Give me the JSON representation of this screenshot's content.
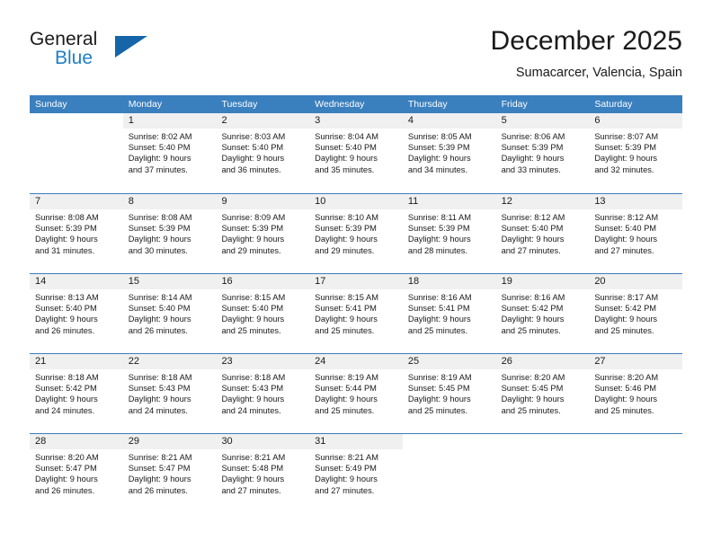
{
  "brand": {
    "name_primary": "General",
    "name_secondary": "Blue",
    "logo_icon": "triangle-logo-icon",
    "accent_color": "#1565a8"
  },
  "header": {
    "title": "December 2025",
    "subtitle": "Sumacarcer, Valencia, Spain"
  },
  "calendar": {
    "header_color": "#3a7fbe",
    "daynum_band_color": "#f0f0f0",
    "weekdays": [
      "Sunday",
      "Monday",
      "Tuesday",
      "Wednesday",
      "Thursday",
      "Friday",
      "Saturday"
    ],
    "weeks": [
      [
        {
          "day": "",
          "sunrise": "",
          "sunset": "",
          "daylight_line1": "",
          "daylight_line2": "",
          "blank": true
        },
        {
          "day": "1",
          "sunrise": "Sunrise: 8:02 AM",
          "sunset": "Sunset: 5:40 PM",
          "daylight_line1": "Daylight: 9 hours",
          "daylight_line2": "and 37 minutes."
        },
        {
          "day": "2",
          "sunrise": "Sunrise: 8:03 AM",
          "sunset": "Sunset: 5:40 PM",
          "daylight_line1": "Daylight: 9 hours",
          "daylight_line2": "and 36 minutes."
        },
        {
          "day": "3",
          "sunrise": "Sunrise: 8:04 AM",
          "sunset": "Sunset: 5:40 PM",
          "daylight_line1": "Daylight: 9 hours",
          "daylight_line2": "and 35 minutes."
        },
        {
          "day": "4",
          "sunrise": "Sunrise: 8:05 AM",
          "sunset": "Sunset: 5:39 PM",
          "daylight_line1": "Daylight: 9 hours",
          "daylight_line2": "and 34 minutes."
        },
        {
          "day": "5",
          "sunrise": "Sunrise: 8:06 AM",
          "sunset": "Sunset: 5:39 PM",
          "daylight_line1": "Daylight: 9 hours",
          "daylight_line2": "and 33 minutes."
        },
        {
          "day": "6",
          "sunrise": "Sunrise: 8:07 AM",
          "sunset": "Sunset: 5:39 PM",
          "daylight_line1": "Daylight: 9 hours",
          "daylight_line2": "and 32 minutes."
        }
      ],
      [
        {
          "day": "7",
          "sunrise": "Sunrise: 8:08 AM",
          "sunset": "Sunset: 5:39 PM",
          "daylight_line1": "Daylight: 9 hours",
          "daylight_line2": "and 31 minutes."
        },
        {
          "day": "8",
          "sunrise": "Sunrise: 8:08 AM",
          "sunset": "Sunset: 5:39 PM",
          "daylight_line1": "Daylight: 9 hours",
          "daylight_line2": "and 30 minutes."
        },
        {
          "day": "9",
          "sunrise": "Sunrise: 8:09 AM",
          "sunset": "Sunset: 5:39 PM",
          "daylight_line1": "Daylight: 9 hours",
          "daylight_line2": "and 29 minutes."
        },
        {
          "day": "10",
          "sunrise": "Sunrise: 8:10 AM",
          "sunset": "Sunset: 5:39 PM",
          "daylight_line1": "Daylight: 9 hours",
          "daylight_line2": "and 29 minutes."
        },
        {
          "day": "11",
          "sunrise": "Sunrise: 8:11 AM",
          "sunset": "Sunset: 5:39 PM",
          "daylight_line1": "Daylight: 9 hours",
          "daylight_line2": "and 28 minutes."
        },
        {
          "day": "12",
          "sunrise": "Sunrise: 8:12 AM",
          "sunset": "Sunset: 5:40 PM",
          "daylight_line1": "Daylight: 9 hours",
          "daylight_line2": "and 27 minutes."
        },
        {
          "day": "13",
          "sunrise": "Sunrise: 8:12 AM",
          "sunset": "Sunset: 5:40 PM",
          "daylight_line1": "Daylight: 9 hours",
          "daylight_line2": "and 27 minutes."
        }
      ],
      [
        {
          "day": "14",
          "sunrise": "Sunrise: 8:13 AM",
          "sunset": "Sunset: 5:40 PM",
          "daylight_line1": "Daylight: 9 hours",
          "daylight_line2": "and 26 minutes."
        },
        {
          "day": "15",
          "sunrise": "Sunrise: 8:14 AM",
          "sunset": "Sunset: 5:40 PM",
          "daylight_line1": "Daylight: 9 hours",
          "daylight_line2": "and 26 minutes."
        },
        {
          "day": "16",
          "sunrise": "Sunrise: 8:15 AM",
          "sunset": "Sunset: 5:40 PM",
          "daylight_line1": "Daylight: 9 hours",
          "daylight_line2": "and 25 minutes."
        },
        {
          "day": "17",
          "sunrise": "Sunrise: 8:15 AM",
          "sunset": "Sunset: 5:41 PM",
          "daylight_line1": "Daylight: 9 hours",
          "daylight_line2": "and 25 minutes."
        },
        {
          "day": "18",
          "sunrise": "Sunrise: 8:16 AM",
          "sunset": "Sunset: 5:41 PM",
          "daylight_line1": "Daylight: 9 hours",
          "daylight_line2": "and 25 minutes."
        },
        {
          "day": "19",
          "sunrise": "Sunrise: 8:16 AM",
          "sunset": "Sunset: 5:42 PM",
          "daylight_line1": "Daylight: 9 hours",
          "daylight_line2": "and 25 minutes."
        },
        {
          "day": "20",
          "sunrise": "Sunrise: 8:17 AM",
          "sunset": "Sunset: 5:42 PM",
          "daylight_line1": "Daylight: 9 hours",
          "daylight_line2": "and 25 minutes."
        }
      ],
      [
        {
          "day": "21",
          "sunrise": "Sunrise: 8:18 AM",
          "sunset": "Sunset: 5:42 PM",
          "daylight_line1": "Daylight: 9 hours",
          "daylight_line2": "and 24 minutes."
        },
        {
          "day": "22",
          "sunrise": "Sunrise: 8:18 AM",
          "sunset": "Sunset: 5:43 PM",
          "daylight_line1": "Daylight: 9 hours",
          "daylight_line2": "and 24 minutes."
        },
        {
          "day": "23",
          "sunrise": "Sunrise: 8:18 AM",
          "sunset": "Sunset: 5:43 PM",
          "daylight_line1": "Daylight: 9 hours",
          "daylight_line2": "and 24 minutes."
        },
        {
          "day": "24",
          "sunrise": "Sunrise: 8:19 AM",
          "sunset": "Sunset: 5:44 PM",
          "daylight_line1": "Daylight: 9 hours",
          "daylight_line2": "and 25 minutes."
        },
        {
          "day": "25",
          "sunrise": "Sunrise: 8:19 AM",
          "sunset": "Sunset: 5:45 PM",
          "daylight_line1": "Daylight: 9 hours",
          "daylight_line2": "and 25 minutes."
        },
        {
          "day": "26",
          "sunrise": "Sunrise: 8:20 AM",
          "sunset": "Sunset: 5:45 PM",
          "daylight_line1": "Daylight: 9 hours",
          "daylight_line2": "and 25 minutes."
        },
        {
          "day": "27",
          "sunrise": "Sunrise: 8:20 AM",
          "sunset": "Sunset: 5:46 PM",
          "daylight_line1": "Daylight: 9 hours",
          "daylight_line2": "and 25 minutes."
        }
      ],
      [
        {
          "day": "28",
          "sunrise": "Sunrise: 8:20 AM",
          "sunset": "Sunset: 5:47 PM",
          "daylight_line1": "Daylight: 9 hours",
          "daylight_line2": "and 26 minutes."
        },
        {
          "day": "29",
          "sunrise": "Sunrise: 8:21 AM",
          "sunset": "Sunset: 5:47 PM",
          "daylight_line1": "Daylight: 9 hours",
          "daylight_line2": "and 26 minutes."
        },
        {
          "day": "30",
          "sunrise": "Sunrise: 8:21 AM",
          "sunset": "Sunset: 5:48 PM",
          "daylight_line1": "Daylight: 9 hours",
          "daylight_line2": "and 27 minutes."
        },
        {
          "day": "31",
          "sunrise": "Sunrise: 8:21 AM",
          "sunset": "Sunset: 5:49 PM",
          "daylight_line1": "Daylight: 9 hours",
          "daylight_line2": "and 27 minutes."
        },
        {
          "day": "",
          "sunrise": "",
          "sunset": "",
          "daylight_line1": "",
          "daylight_line2": "",
          "blank": true
        },
        {
          "day": "",
          "sunrise": "",
          "sunset": "",
          "daylight_line1": "",
          "daylight_line2": "",
          "blank": true
        },
        {
          "day": "",
          "sunrise": "",
          "sunset": "",
          "daylight_line1": "",
          "daylight_line2": "",
          "blank": true
        }
      ]
    ]
  }
}
